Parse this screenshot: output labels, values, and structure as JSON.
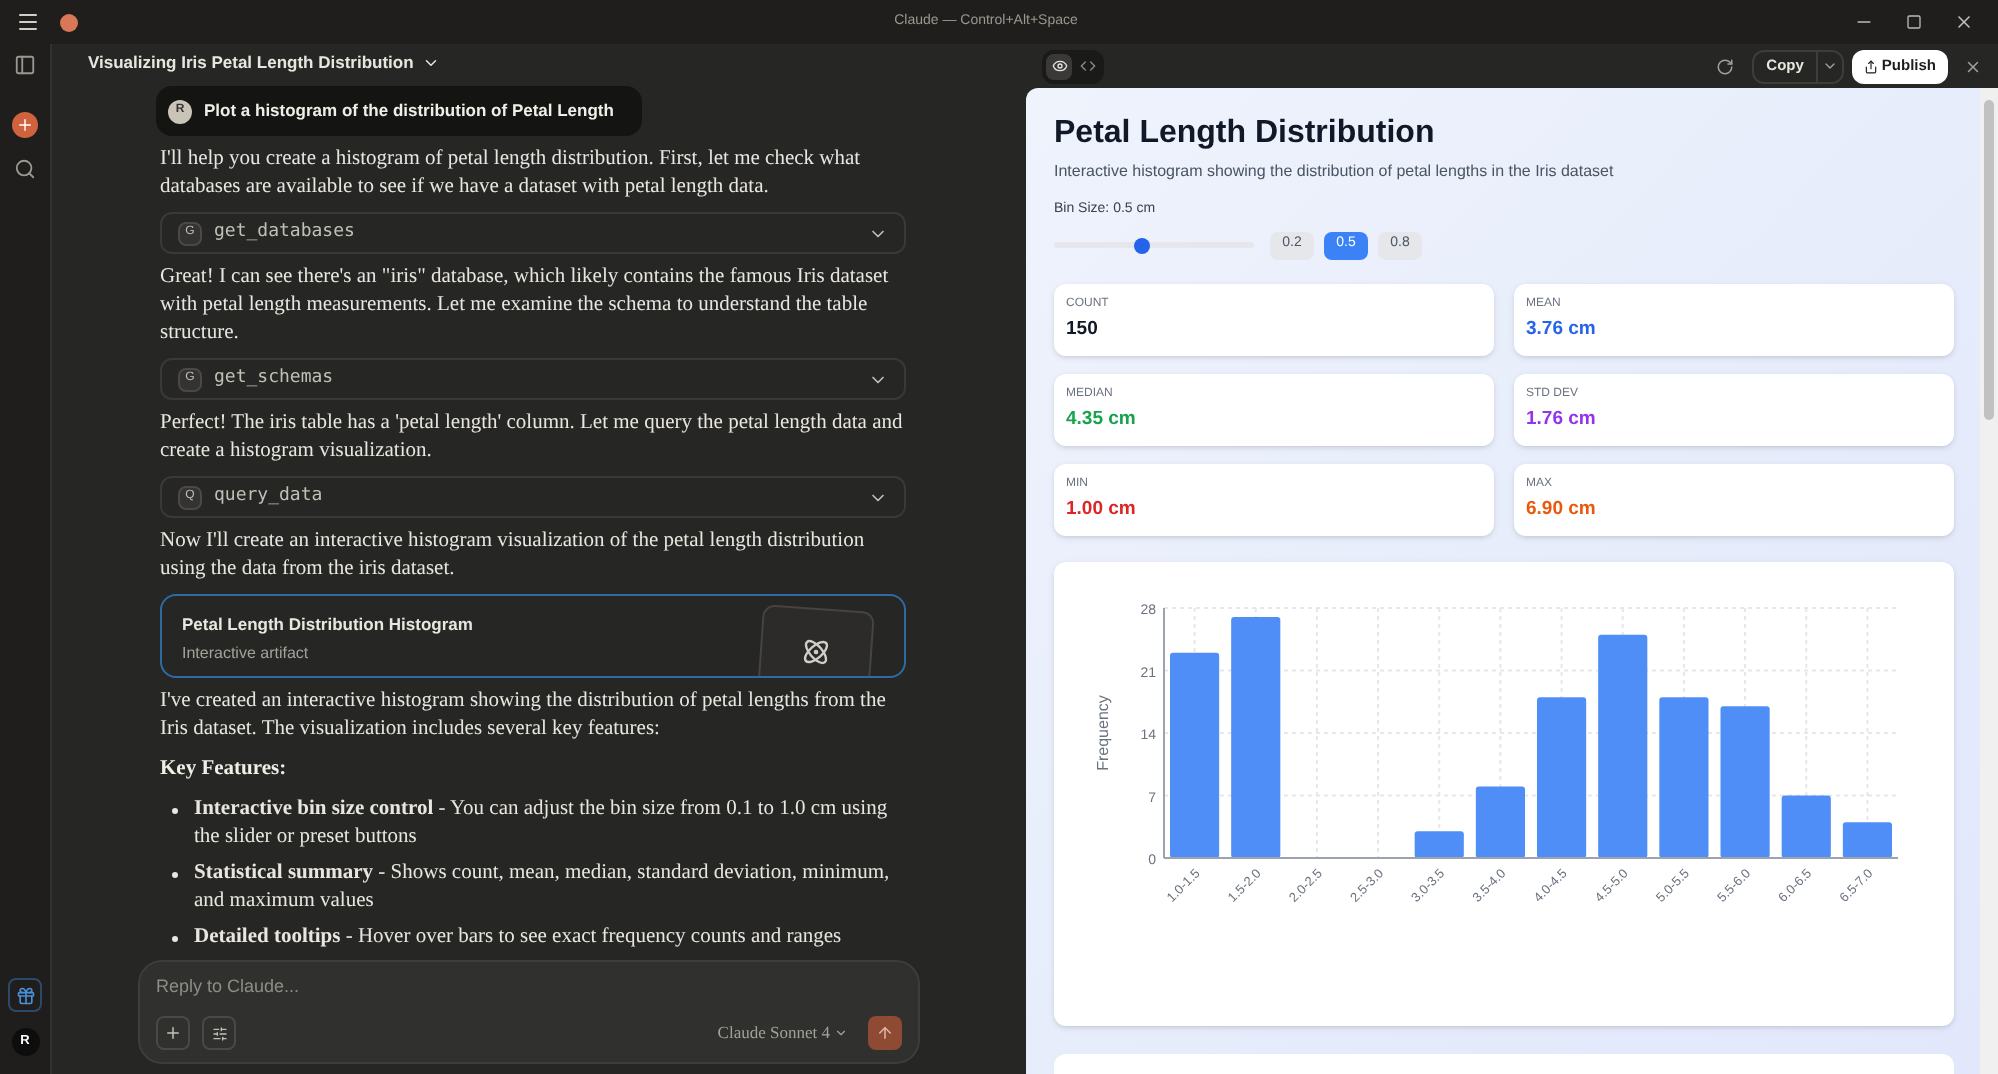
{
  "app_bar": {
    "title": "Claude — Control+Alt+Space"
  },
  "sidebar": {
    "user_initial": "R"
  },
  "conversation": {
    "title": "Visualizing Iris Petal Length Distribution",
    "user_message": {
      "avatar": "R",
      "text": "Plot a histogram of the distribution of Petal Length"
    },
    "blocks": [
      {
        "kind": "text",
        "text": "I'll help you create a histogram of petal length distribution. First, let me check what databases are available to see if we have a dataset with petal length data."
      },
      {
        "kind": "tool",
        "badge": "G",
        "name": "get_databases"
      },
      {
        "kind": "text",
        "text": "Great! I can see there's an \"iris\" database, which likely contains the famous Iris dataset with petal length measurements. Let me examine the schema to understand the table structure."
      },
      {
        "kind": "tool",
        "badge": "G",
        "name": "get_schemas"
      },
      {
        "kind": "text",
        "text": "Perfect! The iris table has a 'petal length' column. Let me query the petal length data and create a histogram visualization."
      },
      {
        "kind": "tool",
        "badge": "Q",
        "name": "query_data"
      },
      {
        "kind": "text",
        "text": "Now I'll create an interactive histogram visualization of the petal length distribution using the data from the iris dataset."
      },
      {
        "kind": "artifact",
        "title": "Petal Length Distribution Histogram",
        "subtitle": "Interactive artifact"
      },
      {
        "kind": "text",
        "text": "I've created an interactive histogram showing the distribution of petal lengths from the Iris dataset. The visualization includes several key features:"
      },
      {
        "kind": "heading",
        "text": "Key Features:"
      },
      {
        "kind": "bullets",
        "items": [
          "**Interactive bin size control** - You can adjust the bin size from 0.1 to 1.0 cm using the slider or preset buttons",
          "**Statistical summary** - Shows count, mean, median, standard deviation, minimum, and maximum values",
          "**Detailed tooltips** - Hover over bars to see exact frequency counts and ranges"
        ]
      }
    ]
  },
  "composer": {
    "placeholder": "Reply to Claude...",
    "model": "Claude Sonnet 4"
  },
  "artifact": {
    "view_tabs": [
      {
        "kind": "preview",
        "selected": true
      },
      {
        "kind": "code",
        "selected": false
      }
    ],
    "copy_label": "Copy",
    "publish_label": "Publish",
    "title": "Petal Length Distribution",
    "subtitle": "Interactive histogram showing the distribution of petal lengths in the Iris dataset",
    "bin_label": "Bin Size: 0.5 cm",
    "slider": {
      "level": 0.44
    },
    "presets": [
      {
        "label": "0.2",
        "selected": false
      },
      {
        "label": "0.5",
        "selected": true
      },
      {
        "label": "0.8",
        "selected": false
      }
    ],
    "stats": [
      {
        "label": "COUNT",
        "value": "150",
        "color": "#111827"
      },
      {
        "label": "MEAN",
        "value": "3.76 cm",
        "color": "#2563eb"
      },
      {
        "label": "MEDIAN",
        "value": "4.35 cm",
        "color": "#16a34a"
      },
      {
        "label": "STD DEV",
        "value": "1.76 cm",
        "color": "#9333ea"
      },
      {
        "label": "MIN",
        "value": "1.00 cm",
        "color": "#dc2626"
      },
      {
        "label": "MAX",
        "value": "6.90 cm",
        "color": "#ea580c"
      }
    ],
    "chart_data": {
      "type": "bar",
      "ylabel": "Frequency",
      "categories": [
        "1.0-1.5",
        "1.5-2.0",
        "2.0-2.5",
        "2.5-3.0",
        "3.0-3.5",
        "3.5-4.0",
        "4.0-4.5",
        "4.5-5.0",
        "5.0-5.5",
        "5.5-6.0",
        "6.0-6.5",
        "6.5-7.0"
      ],
      "grid": true,
      "series": [
        {
          "color": "#4f8ef7",
          "values": [
            23,
            27,
            0,
            0,
            3,
            8,
            18,
            25,
            18,
            17,
            7,
            4
          ]
        }
      ],
      "ylim": [
        0,
        28
      ],
      "yticks": [
        0,
        7,
        14,
        21,
        28
      ]
    }
  }
}
